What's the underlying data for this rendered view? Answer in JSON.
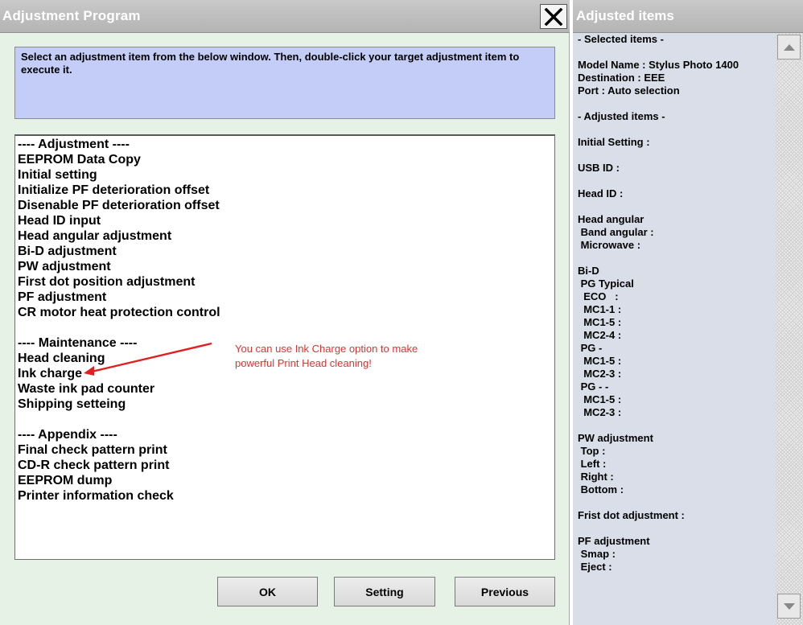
{
  "left_window": {
    "title": "Adjustment Program",
    "instruction": "Select an adjustment item from the below window. Then, double-click your target adjustment item to execute it.",
    "items": [
      "---- Adjustment ----",
      "EEPROM Data Copy",
      "Initial setting",
      "Initialize PF deterioration offset",
      "Disenable PF deterioration offset",
      "Head ID input",
      "Head angular adjustment",
      "Bi-D adjustment",
      "PW adjustment",
      "First dot position adjustment",
      "PF adjustment",
      "CR motor heat protection control",
      "",
      "---- Maintenance ----",
      "Head cleaning",
      "Ink charge",
      "Waste ink pad counter",
      "Shipping setteing",
      "",
      "---- Appendix ----",
      "Final check pattern print",
      "CD-R check pattern print",
      "EEPROM dump",
      "Printer information check"
    ],
    "annotation": {
      "line1": "You can use Ink Charge option to make",
      "line2": "powerful Print Head cleaning!",
      "color": "#e53030"
    },
    "buttons": {
      "ok": "OK",
      "setting": "Setting",
      "previous": "Previous"
    },
    "close_icon": "close-x-icon"
  },
  "right_window": {
    "title": "Adjusted items",
    "lines": [
      "- Selected items -",
      "",
      "Model Name : Stylus Photo 1400",
      "Destination : EEE",
      "Port : Auto selection",
      "",
      "- Adjusted items -",
      "",
      "Initial Setting :",
      "",
      "USB ID :",
      "",
      "Head ID :",
      "",
      "Head angular",
      " Band angular :",
      " Microwave :",
      "",
      "Bi-D",
      " PG Typical",
      "  ECO   :",
      "  MC1-1 :",
      "  MC1-5 :",
      "  MC2-4 :",
      " PG -",
      "  MC1-5 :",
      "  MC2-3 :",
      " PG - -",
      "  MC1-5 :",
      "  MC2-3 :",
      "",
      "PW adjustment",
      " Top :",
      " Left :",
      " Right :",
      " Bottom :",
      "",
      "Frist dot adjustment :",
      "",
      "PF adjustment",
      " Smap :",
      " Eject :"
    ]
  }
}
